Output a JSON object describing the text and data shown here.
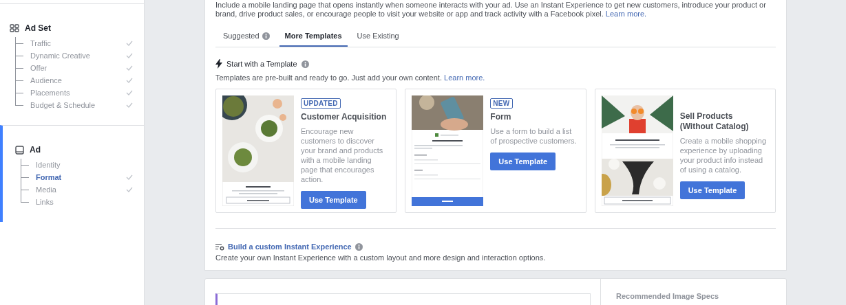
{
  "sidebar": {
    "sections": [
      {
        "title": "Ad Set",
        "selected": false,
        "items": [
          {
            "label": "Traffic",
            "checked": true,
            "selected": false
          },
          {
            "label": "Dynamic Creative",
            "checked": true,
            "selected": false
          },
          {
            "label": "Offer",
            "checked": true,
            "selected": false
          },
          {
            "label": "Audience",
            "checked": true,
            "selected": false
          },
          {
            "label": "Placements",
            "checked": true,
            "selected": false
          },
          {
            "label": "Budget & Schedule",
            "checked": true,
            "selected": false
          }
        ]
      },
      {
        "title": "Ad",
        "selected": true,
        "items": [
          {
            "label": "Identity",
            "checked": false,
            "selected": false
          },
          {
            "label": "Format",
            "checked": true,
            "selected": true
          },
          {
            "label": "Media",
            "checked": true,
            "selected": false
          },
          {
            "label": "Links",
            "checked": false,
            "selected": false
          }
        ]
      }
    ]
  },
  "intro": {
    "text": "Include a mobile landing page that opens instantly when someone interacts with your ad. Use an Instant Experience to get new customers, introduce your product or brand, drive product sales, or encourage people to visit your website or app and track activity with a Facebook pixel.",
    "link": "Learn more."
  },
  "tabs": [
    {
      "label": "Suggested",
      "info": true,
      "selected": false
    },
    {
      "label": "More Templates",
      "info": false,
      "selected": true
    },
    {
      "label": "Use Existing",
      "info": false,
      "selected": false
    }
  ],
  "template_section": {
    "title": "Start with a Template",
    "description": "Templates are pre-built and ready to go. Just add your own content.",
    "link": "Learn more."
  },
  "templates": [
    {
      "badge": "UPDATED",
      "title": "Customer Acquisition",
      "description": "Encourage new customers to discover your brand and products with a mobile landing page that encourages action.",
      "button": "Use Template",
      "preview": {
        "kind": "landing"
      }
    },
    {
      "badge": "NEW",
      "title": "Form",
      "description": "Use a form to build a list of prospective customers.",
      "button": "Use Template",
      "preview": {
        "kind": "form"
      }
    },
    {
      "title": "Sell Products (Without Catalog)",
      "description": "Create a mobile shopping experience by uploading your product info instead of using a catalog.",
      "button": "Use Template",
      "preview": {
        "kind": "shop"
      }
    }
  ],
  "custom": {
    "link": "Build a custom Instant Experience",
    "description": "Create your own Instant Experience with a custom layout and more design and interaction options."
  },
  "image_specs": {
    "heading": "Recommended Image Specs"
  }
}
